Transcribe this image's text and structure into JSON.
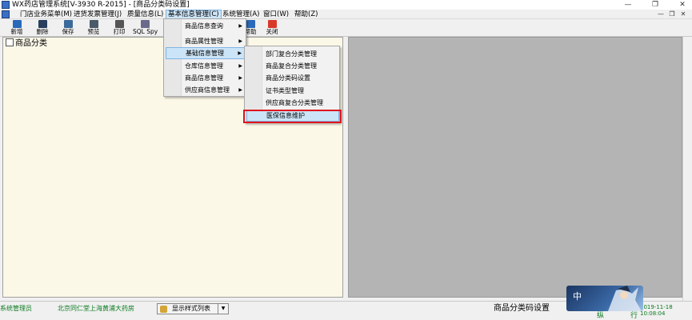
{
  "window": {
    "title": "WX药店管理系统[V-3930 R-2015] - [商品分类码设置]",
    "controls": {
      "minimize": "—",
      "restore": "❐",
      "close": "✕"
    }
  },
  "menubar": {
    "items": [
      {
        "label": "门店业务菜单(M)"
      },
      {
        "label": "进货发票管理(J)"
      },
      {
        "label": "质量信息(L)"
      },
      {
        "label": "基本信息管理(C)"
      },
      {
        "label": "系统管理(A)"
      },
      {
        "label": "窗口(W)"
      },
      {
        "label": "帮助(Z)"
      }
    ],
    "mdi_controls": {
      "minimize": "—",
      "restore": "❐",
      "close": "✕"
    }
  },
  "toolbar": {
    "buttons": [
      {
        "label": "新增",
        "icon": "new-icon",
        "color": "#2a6ab8"
      },
      {
        "label": "删除",
        "icon": "delete-icon",
        "color": "#2a3f5f"
      },
      {
        "label": "保存",
        "icon": "save-icon",
        "color": "#3b6a9a"
      },
      {
        "label": "预览",
        "icon": "preview-icon",
        "color": "#4a5a6a"
      },
      {
        "label": "打印",
        "icon": "print-icon",
        "color": "#555555"
      },
      {
        "label": "SQL Spy",
        "icon": "sql-spy-icon",
        "color": "#6a6a8a"
      },
      {
        "label": "帮助",
        "icon": "help-icon",
        "color": "#2a6ab8"
      },
      {
        "label": "关闭",
        "icon": "close-icon",
        "color": "#d83a2a"
      }
    ]
  },
  "left_panel": {
    "tree_root": "商品分类"
  },
  "menu_level1": {
    "items": [
      {
        "label": "商品信息查询",
        "has_submenu": true
      },
      {
        "label": "商品属性管理",
        "has_submenu": true
      },
      {
        "label": "基础信息管理",
        "has_submenu": true
      },
      {
        "label": "仓库信息管理",
        "has_submenu": true
      },
      {
        "label": "商品信息管理",
        "has_submenu": true
      },
      {
        "label": "供应商信息管理",
        "has_submenu": true
      }
    ]
  },
  "menu_level2": {
    "items": [
      {
        "label": "部门复合分类管理"
      },
      {
        "label": "商品复合分类管理"
      },
      {
        "label": "商品分类码设置"
      },
      {
        "label": "证书类型管理"
      },
      {
        "label": "供应商复合分类管理"
      },
      {
        "label": "医保信息维护"
      }
    ]
  },
  "statusbar": {
    "user": "系统管理员",
    "store": "北京同仁堂上海黄浦大药房",
    "view_combo": "显示样式列表",
    "form_name": "商品分类码设置",
    "ime_mode": "中",
    "date": "2019-11-18",
    "time": "10:08:04",
    "extra": "",
    "num_left": "纵",
    "num_right": "行"
  },
  "colors": {
    "accent": "#cce4f7",
    "highlight_border": "#e0141e",
    "panel_bg": "#fcf8e8",
    "mdi_bg": "#b4b4b4",
    "status_text": "#0a7a1e"
  }
}
